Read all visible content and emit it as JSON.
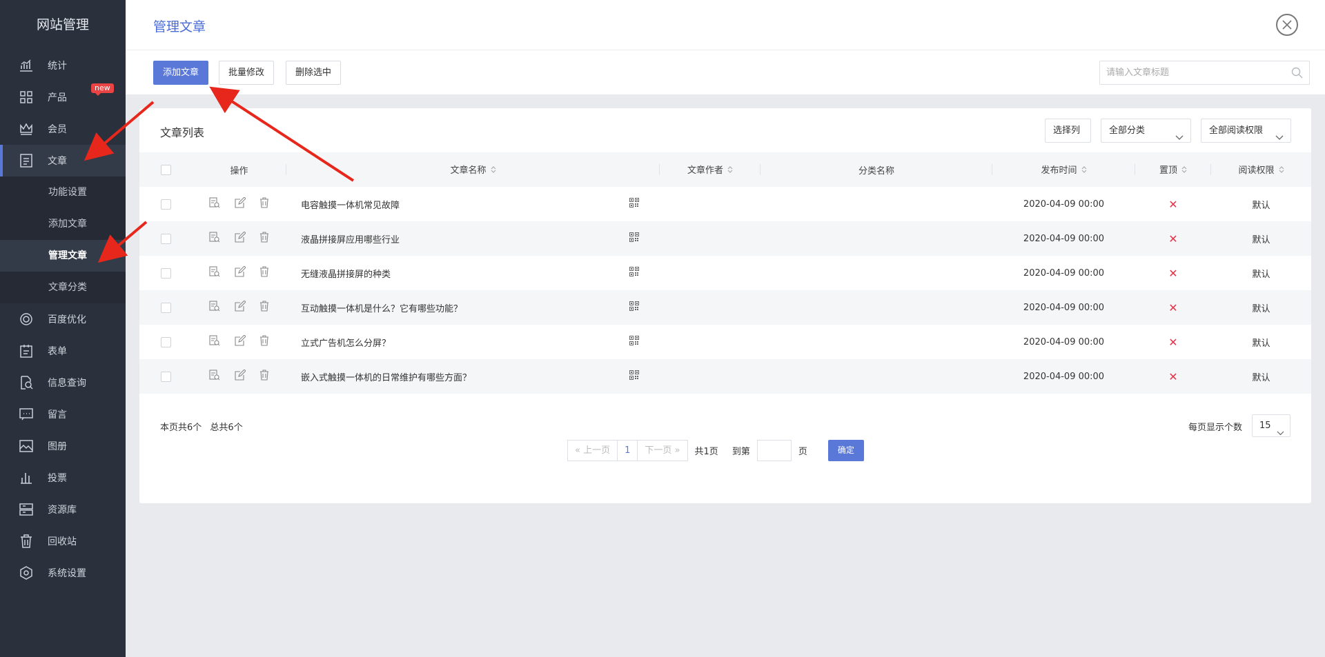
{
  "sidebar": {
    "title": "网站管理",
    "badge": "new",
    "items": [
      {
        "label": "统计",
        "icon": "stats-icon"
      },
      {
        "label": "产品",
        "icon": "grid-icon"
      },
      {
        "label": "会员",
        "icon": "crown-icon"
      },
      {
        "label": "文章",
        "icon": "article-icon"
      },
      {
        "label": "百度优化",
        "icon": "target-icon"
      },
      {
        "label": "表单",
        "icon": "clipboard-icon"
      },
      {
        "label": "信息查询",
        "icon": "search-doc-icon"
      },
      {
        "label": "留言",
        "icon": "message-icon"
      },
      {
        "label": "图册",
        "icon": "image-icon"
      },
      {
        "label": "投票",
        "icon": "bar-chart-icon"
      },
      {
        "label": "资源库",
        "icon": "storage-icon"
      },
      {
        "label": "回收站",
        "icon": "trash-icon"
      },
      {
        "label": "系统设置",
        "icon": "settings-icon"
      }
    ],
    "subitems": [
      "功能设置",
      "添加文章",
      "管理文章",
      "文章分类"
    ]
  },
  "header": {
    "title": "管理文章"
  },
  "toolbar": {
    "add_label": "添加文章",
    "batch_label": "批量修改",
    "delete_label": "删除选中",
    "search_placeholder": "请输入文章标题"
  },
  "card": {
    "title": "文章列表",
    "select_columns": "选择列",
    "category_filter": "全部分类",
    "permission_filter": "全部阅读权限"
  },
  "table": {
    "headers": {
      "ops": "操作",
      "name": "文章名称",
      "author": "文章作者",
      "category": "分类名称",
      "time": "发布时间",
      "top": "置顶",
      "permission": "阅读权限"
    },
    "rows": [
      {
        "name": "电容触摸一体机常见故障",
        "author": "",
        "category": "",
        "time": "2020-04-09 00:00",
        "top": "✕",
        "permission": "默认"
      },
      {
        "name": "液晶拼接屏应用哪些行业",
        "author": "",
        "category": "",
        "time": "2020-04-09 00:00",
        "top": "✕",
        "permission": "默认"
      },
      {
        "name": "无缝液晶拼接屏的种类",
        "author": "",
        "category": "",
        "time": "2020-04-09 00:00",
        "top": "✕",
        "permission": "默认"
      },
      {
        "name": "互动触摸一体机是什么？它有哪些功能？",
        "author": "",
        "category": "",
        "time": "2020-04-09 00:00",
        "top": "✕",
        "permission": "默认"
      },
      {
        "name": "立式广告机怎么分屏？",
        "author": "",
        "category": "",
        "time": "2020-04-09 00:00",
        "top": "✕",
        "permission": "默认"
      },
      {
        "name": "嵌入式触摸一体机的日常维护有哪些方面？",
        "author": "",
        "category": "",
        "time": "2020-04-09 00:00",
        "top": "✕",
        "permission": "默认"
      }
    ]
  },
  "footer": {
    "page_count": "本页共6个",
    "total_count": "总共6个",
    "per_page_label": "每页显示个数",
    "per_page_value": "15"
  },
  "pager": {
    "prev": "上一页",
    "current": "1",
    "next": "下一页",
    "total_pages": "共1页",
    "goto": "到第",
    "page_unit": "页",
    "confirm": "确定"
  },
  "colors": {
    "accent": "#5a78d8",
    "sidebar_bg": "#2a303c",
    "danger": "#e2334a",
    "annotation": "#e8271c"
  }
}
